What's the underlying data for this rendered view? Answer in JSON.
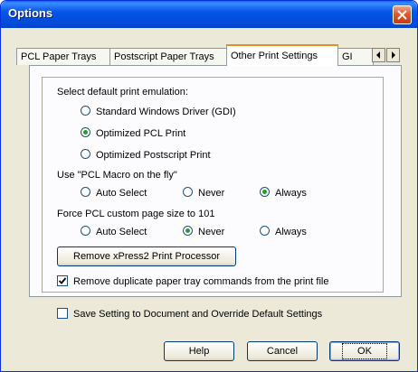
{
  "window": {
    "title": "Options"
  },
  "tabs": [
    {
      "label": "PCL Paper Trays"
    },
    {
      "label": "Postscript Paper Trays"
    },
    {
      "label": "Other Print Settings"
    },
    {
      "label": "GI"
    }
  ],
  "emulation": {
    "label": "Select default print emulation:",
    "options": [
      {
        "label": "Standard Windows Driver (GDI)",
        "selected": false
      },
      {
        "label": "Optimized PCL Print",
        "selected": true
      },
      {
        "label": "Optimized Postscript Print",
        "selected": false
      }
    ]
  },
  "pcl_macro": {
    "label": "Use \"PCL Macro on the fly\"",
    "options": [
      {
        "label": "Auto Select",
        "selected": false
      },
      {
        "label": "Never",
        "selected": false
      },
      {
        "label": "Always",
        "selected": true
      }
    ]
  },
  "force_pcl": {
    "label": "Force PCL custom page size to 101",
    "options": [
      {
        "label": "Auto Select",
        "selected": false
      },
      {
        "label": "Never",
        "selected": true
      },
      {
        "label": "Always",
        "selected": false
      }
    ]
  },
  "remove_processor_button": {
    "label": "Remove xPress2 Print Processor",
    "mnemonic": "R"
  },
  "remove_duplicate": {
    "label": "Remove duplicate paper tray commands from the print file",
    "checked": true
  },
  "save_setting": {
    "label": "Save Setting to Document and Override Default Settings",
    "checked": false
  },
  "buttons": {
    "help": "Help",
    "cancel": "Cancel",
    "ok": "OK"
  }
}
